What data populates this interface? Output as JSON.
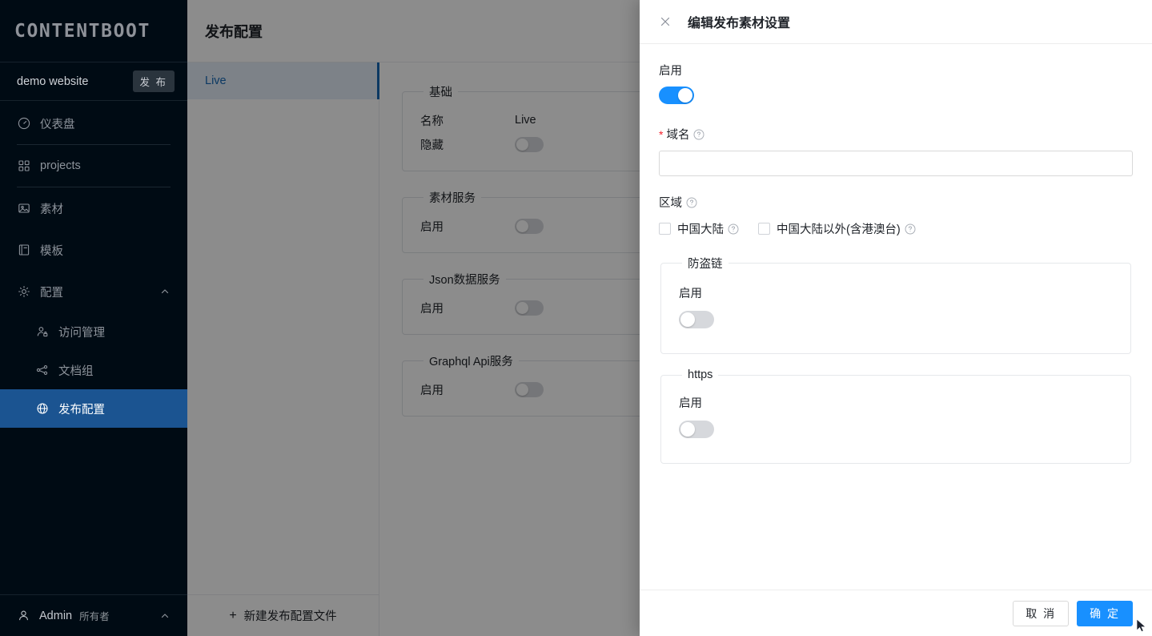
{
  "sidebar": {
    "brand": "CONTENTBOOT",
    "site": {
      "name": "demo website",
      "publish_label": "发 布"
    },
    "items": [
      {
        "label": "仪表盘",
        "icon": "dashboard-icon"
      },
      {
        "label": "projects",
        "icon": "grid-icon"
      },
      {
        "label": "素材",
        "icon": "image-icon"
      },
      {
        "label": "模板",
        "icon": "template-icon"
      },
      {
        "label": "配置",
        "icon": "gear-icon"
      }
    ],
    "sub_items": [
      {
        "label": "访问管理",
        "icon": "user-lock-icon"
      },
      {
        "label": "文档组",
        "icon": "sitemap-icon"
      },
      {
        "label": "发布配置",
        "icon": "globe-icon"
      }
    ],
    "user": {
      "name": "Admin",
      "role": "所有者"
    }
  },
  "main": {
    "title": "发布配置",
    "list": {
      "items": [
        {
          "label": "Live"
        }
      ],
      "new_label": "新建发布配置文件",
      "plus": "+"
    },
    "detail": {
      "sections": [
        {
          "legend": "基础",
          "rows": [
            {
              "label": "名称",
              "type": "text",
              "value": "Live"
            },
            {
              "label": "隐藏",
              "type": "switch",
              "value": "off"
            }
          ]
        },
        {
          "legend": "素材服务",
          "rows": [
            {
              "label": "启用",
              "type": "switch",
              "value": "off"
            }
          ]
        },
        {
          "legend": "Json数据服务",
          "rows": [
            {
              "label": "启用",
              "type": "switch",
              "value": "off"
            }
          ]
        },
        {
          "legend": "Graphql Api服务",
          "rows": [
            {
              "label": "启用",
              "type": "switch",
              "value": "off"
            }
          ]
        }
      ]
    }
  },
  "drawer": {
    "title": "编辑发布素材设置",
    "close_icon": "close-icon",
    "enable": {
      "label": "启用",
      "value": "on"
    },
    "domain": {
      "label": "域名",
      "required_mark": "*",
      "value": "",
      "placeholder": "",
      "help_icon": "question-circle-icon"
    },
    "region": {
      "label": "区域",
      "help_icon": "question-circle-icon",
      "options": [
        {
          "label": "中国大陆",
          "checked": false
        },
        {
          "label": "中国大陆以外(含港澳台)",
          "checked": false
        }
      ]
    },
    "fieldsets": [
      {
        "legend": "防盗链",
        "sublabel": "启用",
        "value": "off"
      },
      {
        "legend": "https",
        "sublabel": "启用",
        "value": "off"
      }
    ],
    "footer": {
      "cancel": "取 消",
      "confirm": "确 定"
    }
  },
  "colors": {
    "sidebar_bg": "#000b14",
    "accent_blue": "#1890ff",
    "active_nav": "#1b5491",
    "list_selected": "#1668b5",
    "required_red": "#f5222d"
  }
}
